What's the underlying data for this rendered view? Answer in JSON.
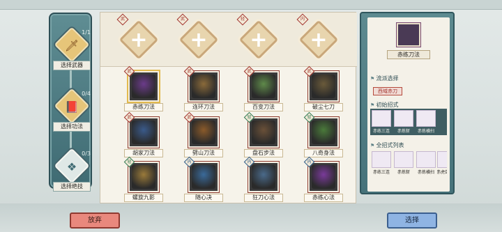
{
  "steps": [
    {
      "label": "选择武器",
      "count": "1/1",
      "icon": "sword-icon"
    },
    {
      "label": "选择功法",
      "count": "0/4",
      "icon": "book-icon"
    },
    {
      "label": "选择绝技",
      "count": "0/3",
      "icon": "emblem-icon"
    }
  ],
  "slots": [
    {
      "tag": "武"
    },
    {
      "tag": "武"
    },
    {
      "tag": "轻"
    },
    {
      "tag": "内"
    }
  ],
  "skills": [
    {
      "name": "赤练刀法",
      "tag": "武",
      "color": "#6b3b8a",
      "selected": true
    },
    {
      "name": "连环刀法",
      "tag": "武",
      "color": "#8a6a3a"
    },
    {
      "name": "百变刀法",
      "tag": "武",
      "color": "#5f8a4a"
    },
    {
      "name": "破尘七刀",
      "tag": "武",
      "color": "#6a5a3a"
    },
    {
      "name": "胡家刀法",
      "tag": "武",
      "color": "#3a5a8a"
    },
    {
      "name": "劈山刀法",
      "tag": "武",
      "color": "#8a5a2a"
    },
    {
      "name": "盘石步法",
      "tag": "轻",
      "color": "#6a5038"
    },
    {
      "name": "八奇身法",
      "tag": "轻",
      "color": "#4a7a3a"
    },
    {
      "name": "螺旋九影",
      "tag": "轻",
      "color": "#9a7a3a"
    },
    {
      "name": "随心决",
      "tag": "内",
      "color": "#3a6a9a"
    },
    {
      "name": "狂刀心法",
      "tag": "内",
      "color": "#4a6a8a"
    },
    {
      "name": "赤练心法",
      "tag": "内",
      "color": "#7a3a9a"
    }
  ],
  "detail": {
    "title": "赤练刀法",
    "school_heading": "流派选择",
    "school": "西域赤刀",
    "start_heading": "初始招式",
    "start_moves": [
      "赤练三连",
      "赤炼斩",
      "赤炼横扫"
    ],
    "all_heading": "全招式列表",
    "all_moves": [
      "赤练三连",
      "赤炼斩",
      "赤炼横扫",
      "赤虎剑"
    ]
  },
  "buttons": {
    "abandon": "放弃",
    "choose": "选择"
  },
  "colors": {
    "panel": "#4f7c83",
    "gold": "#e6c579",
    "red_tag": "#a0302a"
  }
}
